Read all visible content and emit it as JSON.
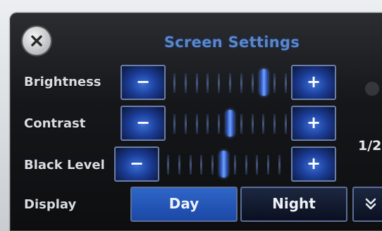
{
  "header": {
    "title": "Screen Settings"
  },
  "rows": [
    {
      "label": "Brightness",
      "minus": "−",
      "plus": "+",
      "level": 0.8
    },
    {
      "label": "Contrast",
      "minus": "−",
      "plus": "+",
      "level": 0.5
    },
    {
      "label": "Black Level",
      "minus": "−",
      "plus": "+",
      "level": 0.5
    }
  ],
  "display": {
    "label": "Display",
    "day": "Day",
    "night": "Night",
    "selected": "Day"
  },
  "page": {
    "indicator": "1/2"
  },
  "colors": {
    "accent": "#2f66c8",
    "title": "#5b86c8"
  },
  "icons": {
    "close": "close-icon",
    "scroll_down": "double-chevron-down-icon",
    "scroll_up": "scroll-up-icon"
  }
}
